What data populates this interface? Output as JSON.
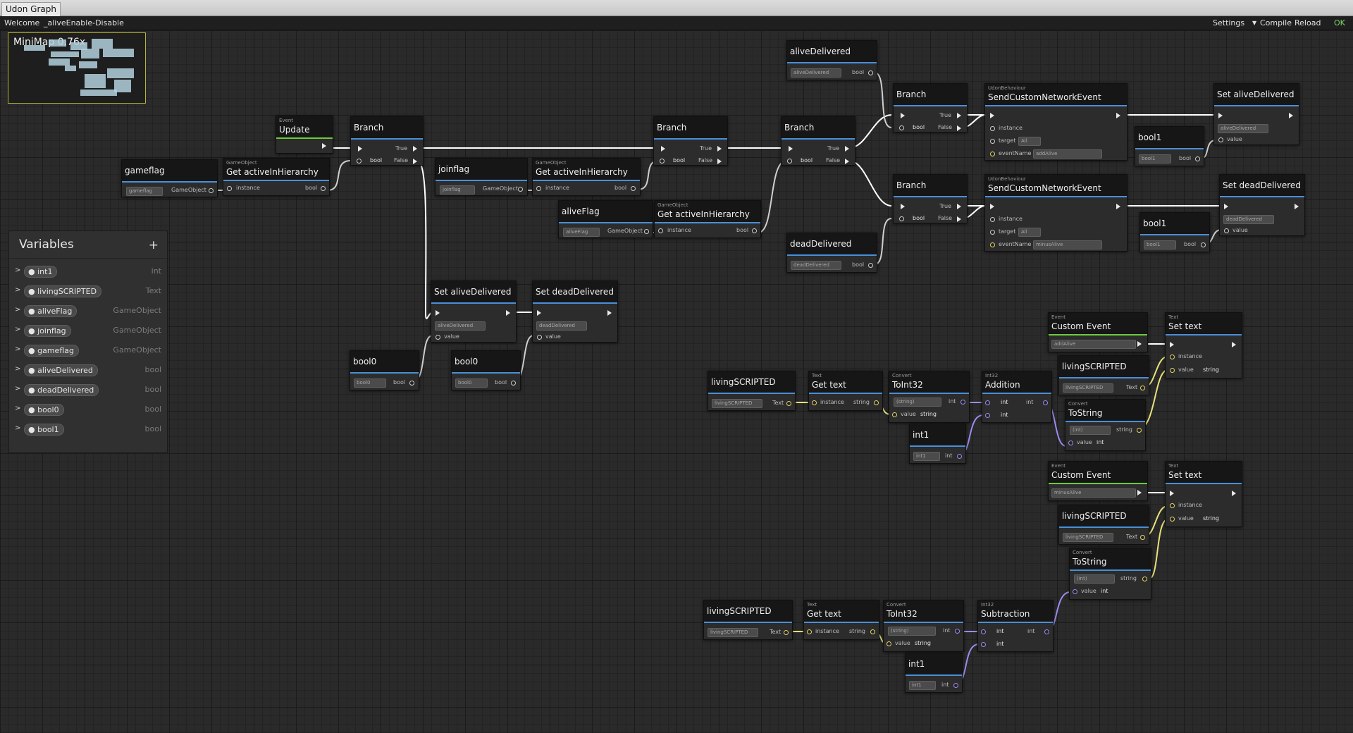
{
  "window": {
    "tab_title": "Udon Graph"
  },
  "toolbar": {
    "welcome": "Welcome",
    "graph_name": "_aliveEnable-Disable",
    "settings": "Settings",
    "compile": "Compile",
    "reload": "Reload",
    "ok": "OK"
  },
  "minimap": {
    "label": "MiniMap  0.76x"
  },
  "variables": {
    "title": "Variables",
    "add": "+",
    "items": [
      {
        "name": "int1",
        "type": "int"
      },
      {
        "name": "livingSCRIPTED",
        "type": "Text"
      },
      {
        "name": "aliveFlag",
        "type": "GameObject"
      },
      {
        "name": "joinflag",
        "type": "GameObject"
      },
      {
        "name": "gameflag",
        "type": "GameObject"
      },
      {
        "name": "aliveDelivered",
        "type": "bool"
      },
      {
        "name": "deadDelivered",
        "type": "bool"
      },
      {
        "name": "bool0",
        "type": "bool"
      },
      {
        "name": "bool1",
        "type": "bool"
      }
    ]
  },
  "labels": {
    "event": "Event",
    "gameobject": "GameObject",
    "text": "Text",
    "convert": "Convert",
    "int32": "Int32",
    "udonbehaviour": "UdonBehaviour",
    "instance": "instance",
    "value": "value",
    "target": "target",
    "eventname": "eventName",
    "true": "True",
    "false": "False",
    "bool": "bool",
    "int": "int",
    "string": "string",
    "all": "All",
    "string_pill": "(string)",
    "int_pill": "(int)"
  },
  "nodes": {
    "update": "Update",
    "gameflag": "gameflag",
    "get_active_1": "Get activeInHierarchy",
    "branch_1": "Branch",
    "joinflag": "joinflag",
    "get_active_2": "Get activeInHierarchy",
    "aliveflag": "aliveFlag",
    "get_active_3": "Get activeInHierarchy",
    "branch_2": "Branch",
    "branch_3": "Branch",
    "alivedelivered": "aliveDelivered",
    "deaddelivered": "deadDelivered",
    "branch_4": "Branch",
    "branch_5": "Branch",
    "send_1": "SendCustomNetworkEvent",
    "send_1_event": "addAlive",
    "send_2": "SendCustomNetworkEvent",
    "send_2_event": "minusAlive",
    "set_alive_right": "Set aliveDelivered",
    "set_dead_right": "Set deadDelivered",
    "bool1_a": "bool1",
    "bool1_b": "bool1",
    "set_alive_mid": "Set aliveDelivered",
    "set_dead_mid": "Set deadDelivered",
    "bool0_a": "bool0",
    "bool0_b": "bool0",
    "custom_event_1": "Custom Event",
    "custom_event_1_name": "addAlive",
    "custom_event_2": "Custom Event",
    "custom_event_2_name": "minusAlive",
    "set_text_1": "Set text",
    "set_text_2": "Set text",
    "living_1": "livingSCRIPTED",
    "living_2": "livingSCRIPTED",
    "living_3": "livingSCRIPTED",
    "living_4": "livingSCRIPTED",
    "get_text_1": "Get text",
    "get_text_2": "Get text",
    "toint_1": "ToInt32",
    "toint_2": "ToInt32",
    "addition": "Addition",
    "subtraction": "Subtraction",
    "int1_a": "int1",
    "int1_b": "int1",
    "tostring_1": "ToString",
    "tostring_2": "ToString"
  },
  "colors": {
    "flow_wire": "#ffffff",
    "bool_wire": "#cfcfcf",
    "string_wire": "#e9e27a",
    "int_wire": "#9c8cf0",
    "event_header": "#6ccb3a",
    "node_header": "#4a8fd8"
  }
}
